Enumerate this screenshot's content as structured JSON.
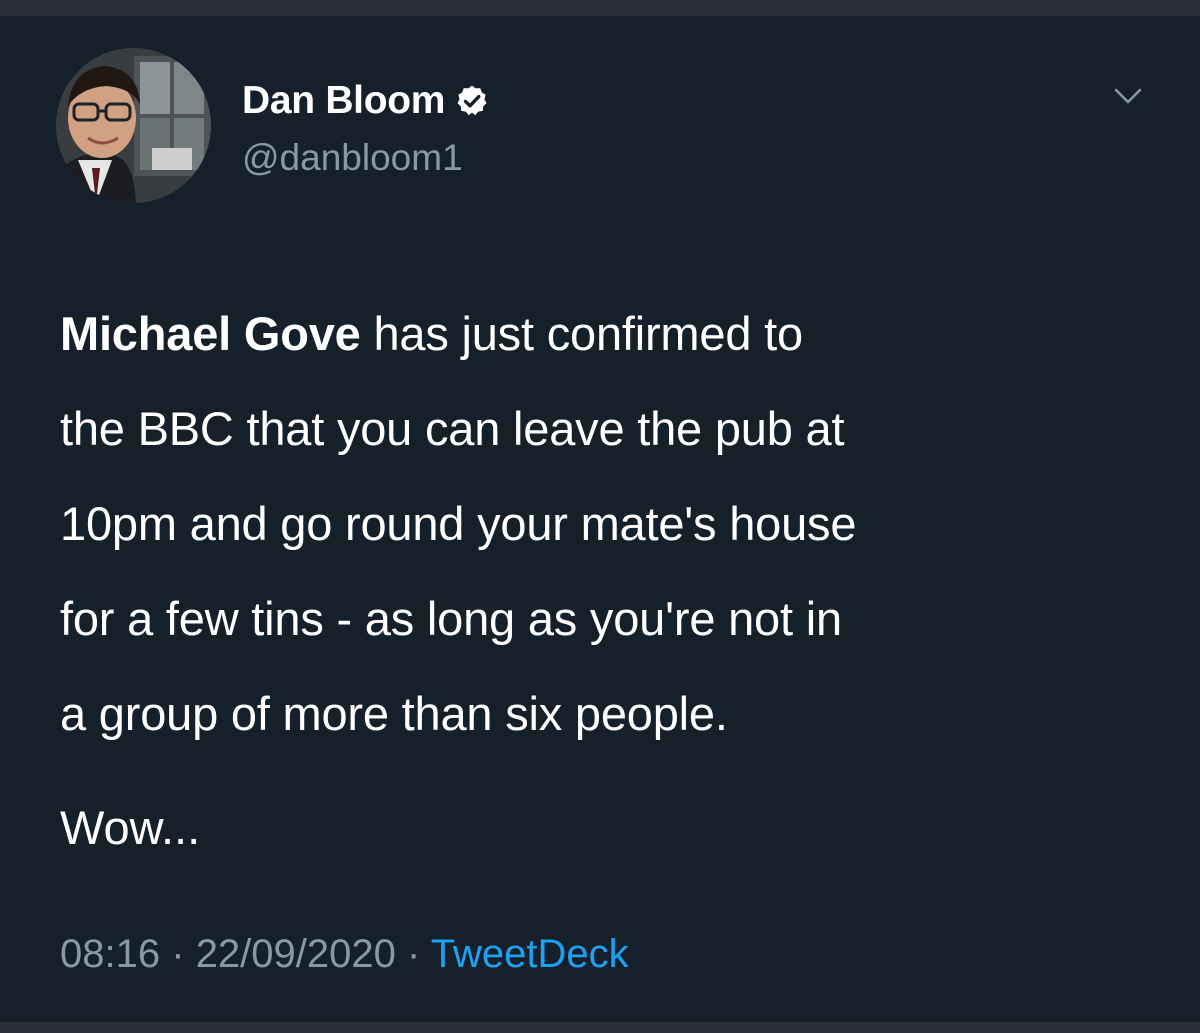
{
  "author": {
    "display_name": "Dan Bloom",
    "handle": "@danbloom1",
    "verified": true
  },
  "tweet": {
    "lines": [
      {
        "bold": "Michael Gove",
        "rest": " has just confirmed to"
      },
      {
        "bold": "",
        "rest": "the BBC that you can leave the pub at"
      },
      {
        "bold": "",
        "rest": "10pm and go round your mate's house"
      },
      {
        "bold": "",
        "rest": "for a few tins - as long as you're not in"
      },
      {
        "bold": "",
        "rest": "a group of more than six people."
      }
    ],
    "coda": "Wow..."
  },
  "meta": {
    "time": "08:16",
    "date": "22/09/2020",
    "separator": "·",
    "source": "TweetDeck"
  },
  "icons": {
    "verified": "verified-badge-icon",
    "menu": "chevron-down-icon"
  },
  "colors": {
    "background": "#15202b",
    "secondary_text": "#8899a6",
    "link": "#1da1f2"
  }
}
